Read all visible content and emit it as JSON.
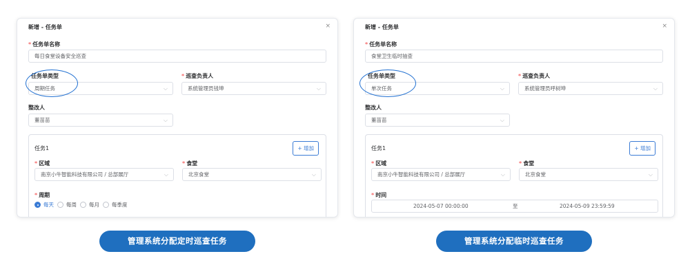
{
  "close_glyph": "×",
  "chevron_glyph": "⌵",
  "left_dialog": {
    "title": "新增 - 任务单",
    "required_mark": "*",
    "name_label": "任务单名称",
    "name_value": "每日食堂设备安全巡查",
    "type_label": "任务单类型",
    "type_value": "周期任务",
    "inspector_label": "巡查负责人",
    "inspector_value": "系统管理员钱坤",
    "rectifier_label": "整改人",
    "rectifier_value": "董苗苗",
    "task_title": "任务1",
    "add_label": "+ 增加",
    "area_label": "区域",
    "area_value": "南京小牛智能科技有限公司 / 总部展厅",
    "canteen_label": "食堂",
    "canteen_value": "北京食堂",
    "period_label": "周期",
    "period_options": [
      "每天",
      "每周",
      "每月",
      "每季度"
    ],
    "period_selected": "每天"
  },
  "right_dialog": {
    "title": "新增 - 任务单",
    "required_mark": "*",
    "name_label": "任务单名称",
    "name_value": "食堂卫生临时抽查",
    "type_label": "任务单类型",
    "type_value": "单次任务",
    "inspector_label": "巡查负责人",
    "inspector_value": "系统管理员呼树坤",
    "rectifier_label": "整改人",
    "rectifier_value": "董苗苗",
    "task_title": "任务1",
    "add_label": "+ 增加",
    "area_label": "区域",
    "area_value": "南京小牛智能科技有限公司 / 总部展厅",
    "canteen_label": "食堂",
    "canteen_value": "北京食堂",
    "time_label": "时间",
    "time_start": "2024-05-07 00:00:00",
    "time_sep": "至",
    "time_end": "2024-05-09 23:59:59"
  },
  "captions": {
    "left": "管理系统分配定时巡查任务",
    "right": "管理系统分配临时巡查任务"
  },
  "colors": {
    "accent": "#3a7bd5",
    "caption_bg": "#1f6fbf",
    "required": "#f56c6c",
    "highlight": "#1f6fd1"
  }
}
